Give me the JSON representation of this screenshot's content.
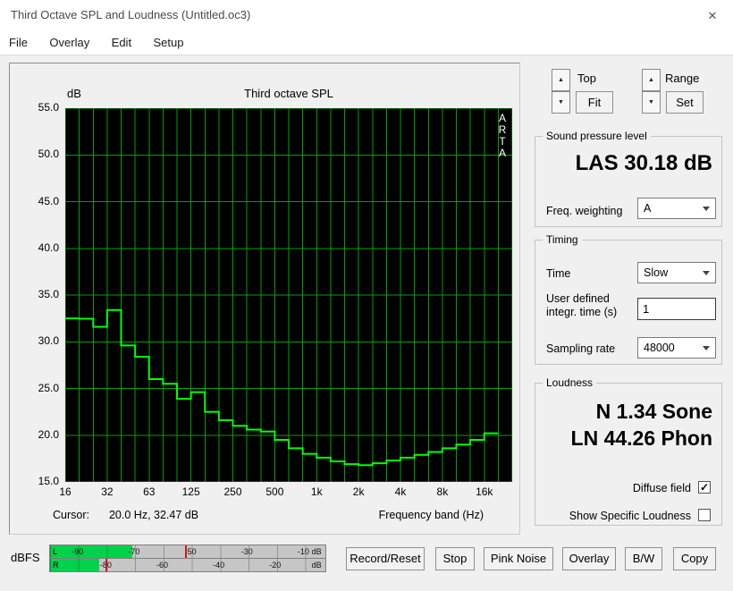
{
  "window": {
    "title": "Third Octave SPL and Loudness (Untitled.oc3)"
  },
  "icons": {
    "close": "✕",
    "check": "✓",
    "up_arrow": "▲",
    "down_arrow": "▼"
  },
  "menu": {
    "items": [
      "File",
      "Overlay",
      "Edit",
      "Setup"
    ]
  },
  "chart_data": {
    "type": "line",
    "title": "Third octave SPL",
    "ylabel": "dB",
    "xlabel": "Frequency band (Hz)",
    "cursor_prefix": "Cursor:",
    "cursor_value": "20.0 Hz, 32.47 dB",
    "watermark": "ARTA",
    "ylim": [
      15.0,
      55.0
    ],
    "ytick_step": 5,
    "yticks": [
      "55.0",
      "50.0",
      "45.0",
      "40.0",
      "35.0",
      "30.0",
      "25.0",
      "20.0",
      "15.0"
    ],
    "xticks": [
      "16",
      "32",
      "63",
      "125",
      "250",
      "500",
      "1k",
      "2k",
      "4k",
      "8k",
      "16k"
    ],
    "bands": [
      "16",
      "20",
      "25",
      "31.5",
      "40",
      "50",
      "63",
      "80",
      "100",
      "125",
      "160",
      "200",
      "250",
      "315",
      "400",
      "500",
      "630",
      "800",
      "1k",
      "1.25k",
      "1.6k",
      "2k",
      "2.5k",
      "3.15k",
      "4k",
      "5k",
      "6.3k",
      "8k",
      "10k",
      "12.5k",
      "16k"
    ],
    "values_db": [
      32.5,
      32.47,
      31.6,
      33.4,
      29.6,
      28.4,
      26.0,
      25.5,
      23.9,
      24.6,
      22.5,
      21.6,
      21.0,
      20.6,
      20.4,
      19.5,
      18.6,
      18.0,
      17.6,
      17.2,
      16.9,
      16.8,
      17.0,
      17.3,
      17.6,
      17.9,
      18.2,
      18.6,
      19.0,
      19.5,
      20.2
    ],
    "colors": {
      "background": "#000000",
      "grid": "#00b400",
      "line": "#00ff00",
      "watermark": "#ffffff"
    }
  },
  "panel": {
    "top_label": "Top",
    "range_label": "Range",
    "fit_button": "Fit",
    "set_button": "Set",
    "spl": {
      "title": "Sound pressure level",
      "value": "LAS 30.18 dB",
      "weighting_label": "Freq. weighting",
      "weighting_value": "A"
    },
    "timing": {
      "title": "Timing",
      "time_label": "Time",
      "time_value": "Slow",
      "integr_label": "User defined integr. time (s)",
      "integr_value": "1",
      "sampling_label": "Sampling rate",
      "sampling_value": "48000"
    },
    "loudness": {
      "title": "Loudness",
      "sone_value": "N 1.34 Sone",
      "phon_value": "LN 44.26 Phon",
      "diffuse_label": "Diffuse field",
      "diffuse_checked": true,
      "specific_label": "Show Specific Loudness",
      "specific_checked": false
    }
  },
  "meter": {
    "dbfs_label": "dBFS",
    "channels": [
      "L",
      "R"
    ],
    "top_scale": [
      "-90",
      "-70",
      "-50",
      "-30",
      "-10"
    ],
    "bottom_scale": [
      "-80",
      "-60",
      "-40",
      "-20"
    ],
    "unit": "dB",
    "levels_pct": {
      "L": 30,
      "R": 18
    },
    "peaks_pct": {
      "L": 49,
      "R": 20
    }
  },
  "controls": {
    "buttons": [
      "Record/Reset",
      "Stop",
      "Pink Noise",
      "Overlay",
      "B/W",
      "Copy"
    ]
  }
}
